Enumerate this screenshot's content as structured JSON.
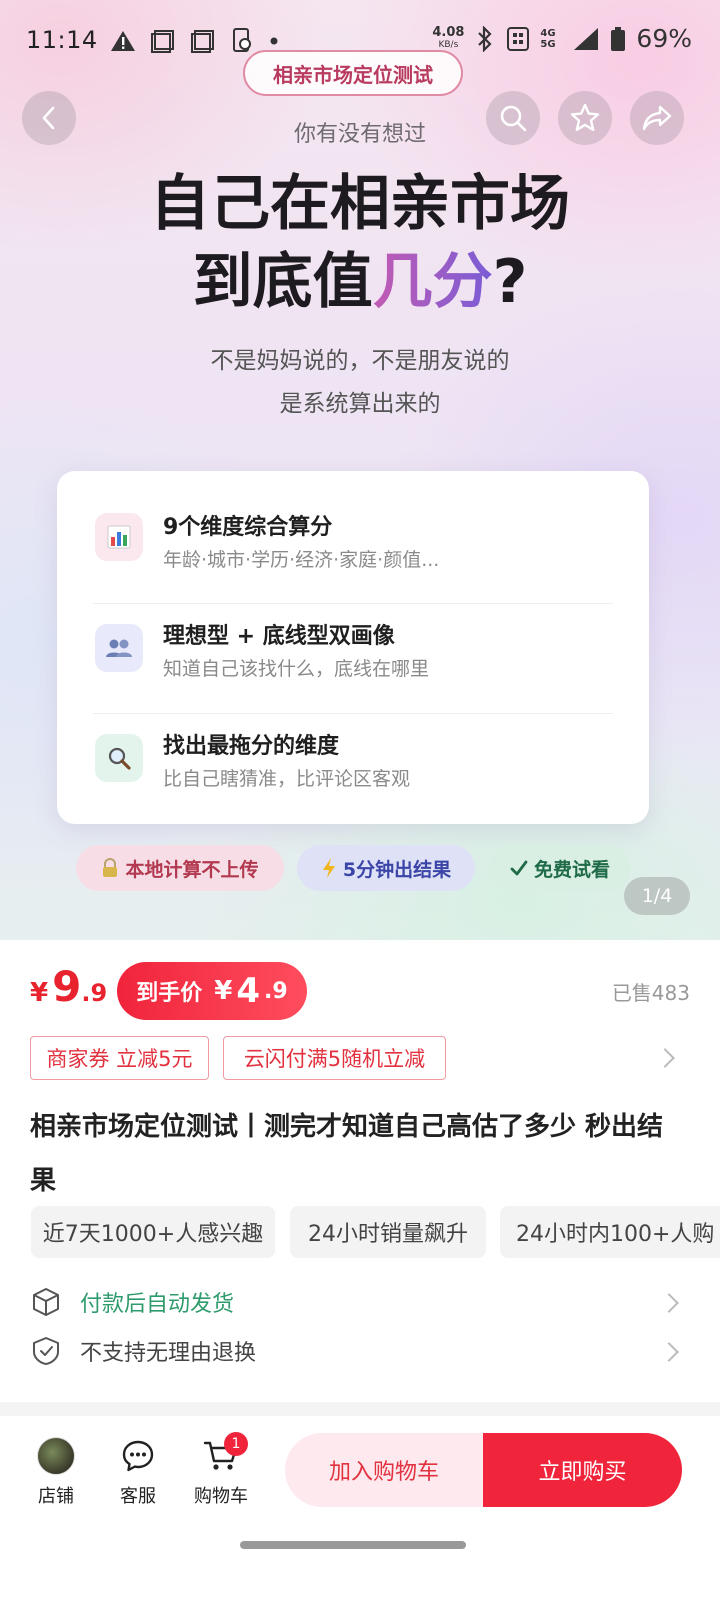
{
  "status_bar": {
    "time": "11:14",
    "net_speed_value": "4.08",
    "net_speed_unit": "KB/s",
    "network_labels": "4G 5G",
    "battery": "69%"
  },
  "hero": {
    "tag": "相亲市场定位测试",
    "subtitle": "你有没有想过",
    "title_line1": "自己在相亲市场",
    "title_line2_prefix": "到底值",
    "title_line2_highlight": "几分",
    "title_line2_suffix": "?",
    "desc_line1": "不是妈妈说的，不是朋友说的",
    "desc_line2": "是系统算出来的",
    "features": [
      {
        "icon": "bar-chart-icon",
        "title": "9个维度综合算分",
        "desc": "年龄·城市·学历·经济·家庭·颜值..."
      },
      {
        "icon": "people-icon",
        "title": "理想型 + 底线型双画像",
        "desc": "知道自己该找什么，底线在哪里"
      },
      {
        "icon": "magnifier-icon",
        "title": "找出最拖分的维度",
        "desc": "比自己瞎猜准，比评论区客观"
      }
    ],
    "badges": [
      {
        "icon": "lock-icon",
        "label": "本地计算不上传"
      },
      {
        "icon": "lightning-icon",
        "label": "5分钟出结果"
      },
      {
        "icon": "check-icon",
        "label": "免费试看"
      }
    ],
    "page_indicator": "1/4"
  },
  "product": {
    "price_currency": "¥",
    "price_int": "9",
    "price_dec": ".9",
    "final_label": "到手价",
    "final_currency": "¥",
    "final_int": "4",
    "final_dec": ".9",
    "sold": "已售483",
    "coupons": [
      "商家券 立减5元",
      "云闪付满5随机立减"
    ],
    "title": "相亲市场定位测试丨测完才知道自己高估了多少 秒出结果",
    "chips": [
      "近7天1000+人感兴趣",
      "24小时销量飙升",
      "24小时内100+人购"
    ],
    "services": [
      "付款后自动发货",
      "不支持无理由退换"
    ]
  },
  "bottom_bar": {
    "store": "店铺",
    "service": "客服",
    "cart": "购物车",
    "cart_count": "1",
    "add_to_cart": "加入购物车",
    "buy_now": "立即购买"
  },
  "colors": {
    "accent_red": "#f0243b",
    "tag_pink": "#b83a5e",
    "service_green": "#2f9b6c"
  }
}
